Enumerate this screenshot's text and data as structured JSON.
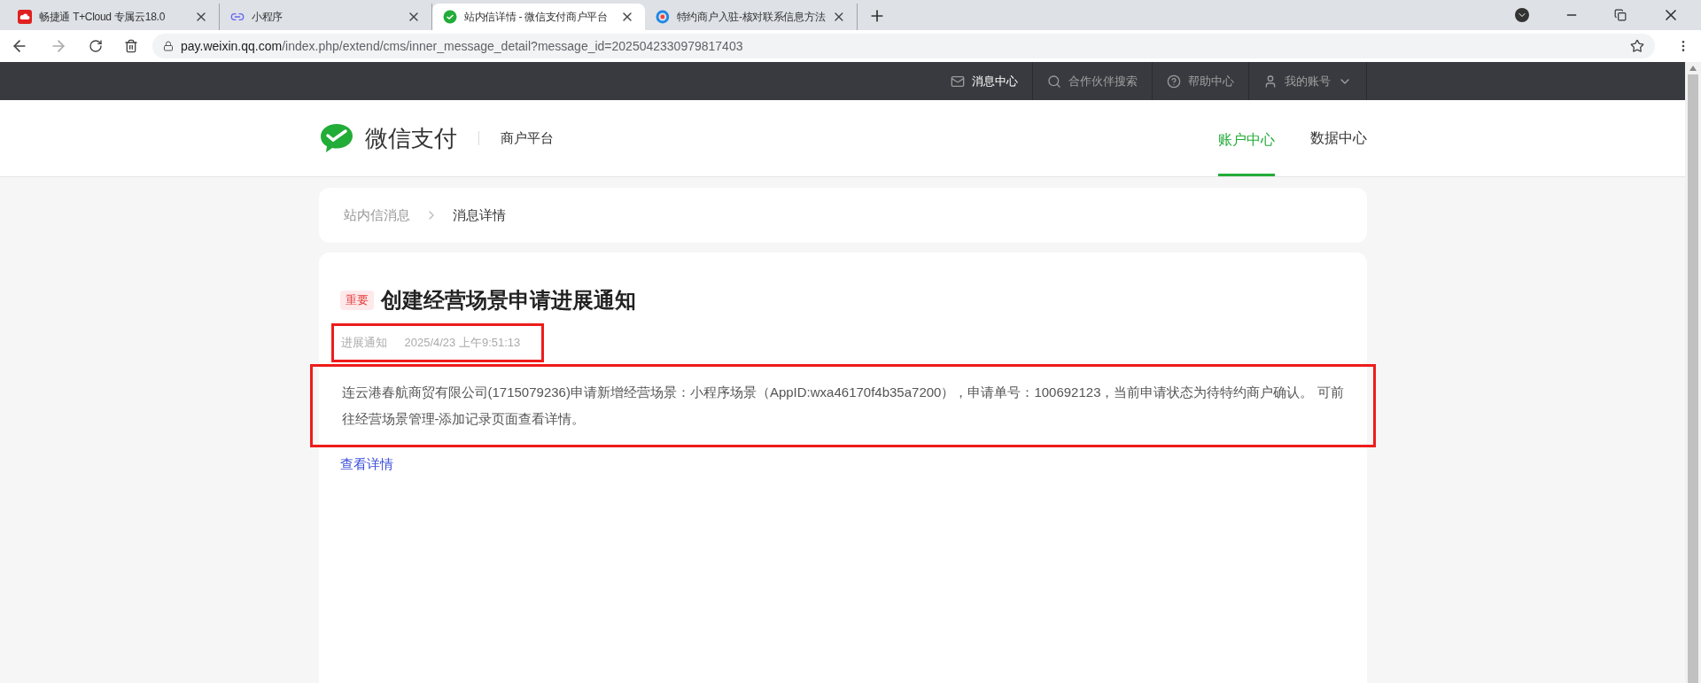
{
  "browser": {
    "tabs": [
      {
        "title": "畅捷通 T+Cloud 专属云18.0",
        "kind": "cloud",
        "selected": false
      },
      {
        "title": "小程序",
        "kind": "link",
        "selected": false
      },
      {
        "title": "站内信详情 - 微信支付商户平台",
        "kind": "wechat",
        "selected": true
      },
      {
        "title": "特约商户入驻-核对联系信息方法",
        "kind": "ring",
        "selected": false
      }
    ],
    "url_host": "pay.weixin.qq.com",
    "url_path": "/index.php/extend/cms/inner_message_detail?message_id=2025042330979817403"
  },
  "top_nav": [
    {
      "label": "消息中心",
      "kind": "mail",
      "selected": true
    },
    {
      "label": "合作伙伴搜索",
      "kind": "search",
      "selected": false
    },
    {
      "label": "帮助中心",
      "kind": "help",
      "selected": false
    },
    {
      "label": "我的账号",
      "kind": "user",
      "selected": false
    }
  ],
  "header": {
    "logo_text": "微信支付",
    "subtitle": "商户平台",
    "nav": [
      {
        "label": "账户中心",
        "selected": true
      },
      {
        "label": "数据中心",
        "selected": false
      }
    ]
  },
  "breadcrumb": [
    {
      "label": "站内信消息",
      "selected": false
    },
    {
      "label": "消息详情",
      "selected": true
    }
  ],
  "message": {
    "badge": "重要",
    "title": "创建经营场景申请进展通知",
    "category": "进展通知",
    "time": "2025/4/23 上午9:51:13",
    "body": "连云港春航商贸有限公司(1715079236)申请新增经营场景：小程序场景（AppID:wxa46170f4b35a7200），申请单号：100692123，当前申请状态为待特约商户确认。 可前往经营场景管理-添加记录页面查看详情。",
    "link": "查看详情"
  }
}
